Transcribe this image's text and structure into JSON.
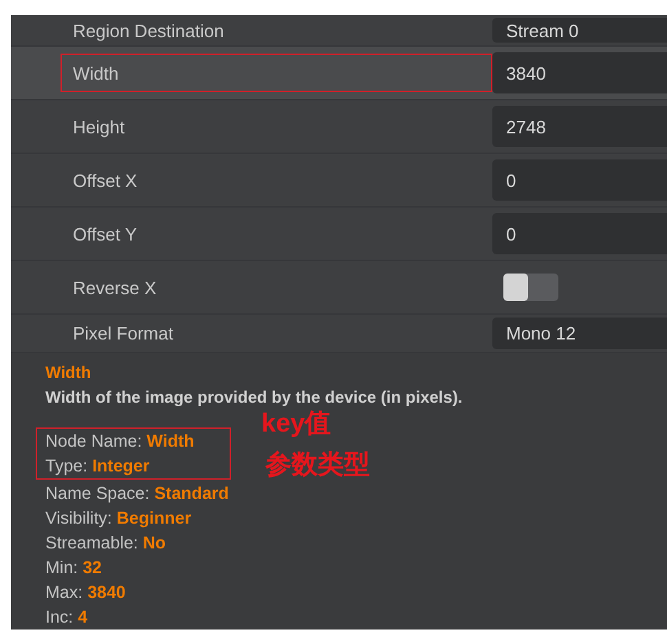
{
  "properties": [
    {
      "label": "Region Destination",
      "value": "Stream 0",
      "kind": "text",
      "selected": false,
      "outlined": false
    },
    {
      "label": "Width",
      "value": "3840",
      "kind": "text",
      "selected": true,
      "outlined": true
    },
    {
      "label": "Height",
      "value": "2748",
      "kind": "text",
      "selected": false,
      "outlined": false
    },
    {
      "label": "Offset X",
      "value": "0",
      "kind": "text",
      "selected": false,
      "outlined": false
    },
    {
      "label": "Offset Y",
      "value": "0",
      "kind": "text",
      "selected": false,
      "outlined": false
    },
    {
      "label": "Reverse X",
      "kind": "switch",
      "on": false,
      "selected": false,
      "outlined": false
    },
    {
      "label": "Pixel Format",
      "value": "Mono 12",
      "kind": "text",
      "selected": false,
      "outlined": false
    }
  ],
  "description": {
    "title": "Width",
    "text": "Width of the image provided by the device (in pixels).",
    "attributes": [
      {
        "name": "Node Name:",
        "value": "Width",
        "outlined": true
      },
      {
        "name": "Type:",
        "value": "Integer",
        "outlined": true
      },
      {
        "name": "Name Space:",
        "value": "Standard",
        "outlined": false
      },
      {
        "name": "Visibility:",
        "value": "Beginner",
        "outlined": false
      },
      {
        "name": "Streamable:",
        "value": "No",
        "outlined": false
      },
      {
        "name": "Min:",
        "value": "32",
        "outlined": false
      },
      {
        "name": "Max:",
        "value": "3840",
        "outlined": false
      },
      {
        "name": "Inc:",
        "value": "4",
        "outlined": false
      }
    ]
  },
  "annotations": [
    {
      "text": "key值"
    },
    {
      "text": "参数类型"
    }
  ]
}
